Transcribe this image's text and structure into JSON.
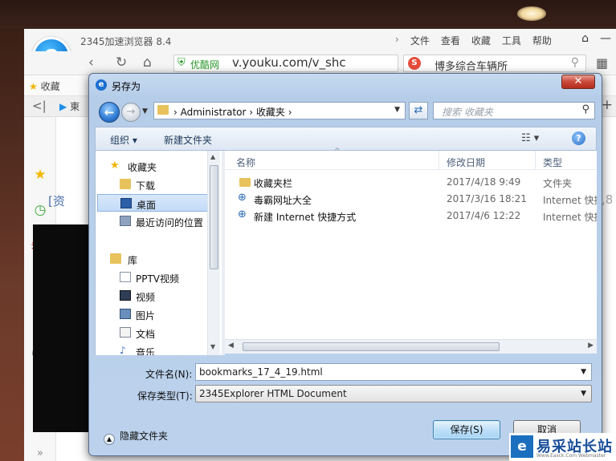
{
  "browser": {
    "name": "2345加速浏览器 8.4",
    "menu": [
      "文件",
      "查看",
      "收藏",
      "工具",
      "帮助"
    ],
    "address": {
      "site_label": "优酷网",
      "url": "v.youku.com/v_shc"
    },
    "search_text": "博多综合车辆所",
    "favorites_label": "收藏",
    "tab_label": "東",
    "content_fragment": "[资",
    "right_fragment": ",8"
  },
  "dialog": {
    "title": "另存为",
    "close_label": "✕",
    "breadcrumb": [
      "Administrator",
      "收藏夹"
    ],
    "search_placeholder": "搜索 收藏夹",
    "toolbar": {
      "organize": "组织 ▾",
      "new_folder": "新建文件夹",
      "help": "?"
    },
    "tree": [
      {
        "label": "收藏夹",
        "icon": "star-folder-icon"
      },
      {
        "label": "下载",
        "icon": "download-folder-icon"
      },
      {
        "label": "桌面",
        "icon": "desktop-icon",
        "selected": true
      },
      {
        "label": "最近访问的位置",
        "icon": "recent-places-icon"
      },
      {
        "label": "库",
        "icon": "library-icon"
      },
      {
        "label": "PPTV视频",
        "icon": "pptv-folder-icon"
      },
      {
        "label": "视频",
        "icon": "videos-icon"
      },
      {
        "label": "图片",
        "icon": "pictures-icon"
      },
      {
        "label": "文档",
        "icon": "documents-icon"
      },
      {
        "label": "音乐",
        "icon": "music-icon"
      }
    ],
    "columns": [
      "名称",
      "修改日期",
      "类型"
    ],
    "files": [
      {
        "name": "收藏夹栏",
        "date": "2017/4/18 9:49",
        "type": "文件夹",
        "icon": "folder-icon"
      },
      {
        "name": "毒霸网址大全",
        "date": "2017/3/16 18:21",
        "type": "Internet 快捷",
        "icon": "internet-shortcut-icon"
      },
      {
        "name": "新建 Internet 快捷方式",
        "date": "2017/4/6 12:22",
        "type": "Internet 快捷",
        "icon": "internet-shortcut-icon"
      }
    ],
    "filename_label": "文件名(N):",
    "filename_value": "bookmarks_17_4_19.html",
    "savetype_label": "保存类型(T):",
    "savetype_value": "2345Explorer HTML Document",
    "hide_folders_label": "隐藏文件夹",
    "save_button": "保存(S)",
    "cancel_button": "取消"
  },
  "watermark": {
    "logo": "e",
    "text": "易采站长站",
    "sub": "Www.Easck.Com Webmaster"
  }
}
